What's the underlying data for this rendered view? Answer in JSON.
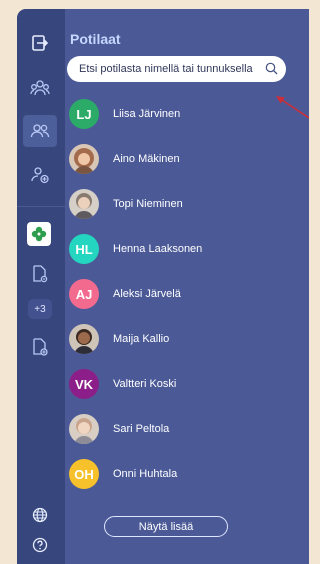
{
  "header": {
    "title": "Potilaat"
  },
  "search": {
    "placeholder": "Etsi potilasta nimellä tai tunnuksella",
    "value": ""
  },
  "patients": [
    {
      "name": "Liisa Järvinen",
      "initials": "LJ",
      "color": "#2bab67",
      "photo": false
    },
    {
      "name": "Aino Mäkinen",
      "initials": "",
      "color": "#a46a4c",
      "photo": true
    },
    {
      "name": "Topi Nieminen",
      "initials": "",
      "color": "#8a7b70",
      "photo": true
    },
    {
      "name": "Henna Laaksonen",
      "initials": "HL",
      "color": "#24d5c0",
      "photo": false
    },
    {
      "name": "Aleksi Järvelä",
      "initials": "AJ",
      "color": "#f26b8e",
      "photo": false
    },
    {
      "name": "Maija Kallio",
      "initials": "",
      "color": "#6b4a36",
      "photo": true
    },
    {
      "name": "Valtteri Koski",
      "initials": "VK",
      "color": "#8b1e88",
      "photo": false
    },
    {
      "name": "Sari Peltola",
      "initials": "",
      "color": "#c9a48d",
      "photo": true
    },
    {
      "name": "Onni Huhtala",
      "initials": "OH",
      "color": "#f6c12a",
      "photo": false
    }
  ],
  "sidebar": {
    "more_count": "+3"
  },
  "footer": {
    "show_more_label": "Näytä lisää"
  },
  "colors": {
    "panel": "#4b5a97",
    "rail": "#37467c",
    "accent_arrow": "#cc2f3a",
    "background": "#f3e7d4"
  }
}
